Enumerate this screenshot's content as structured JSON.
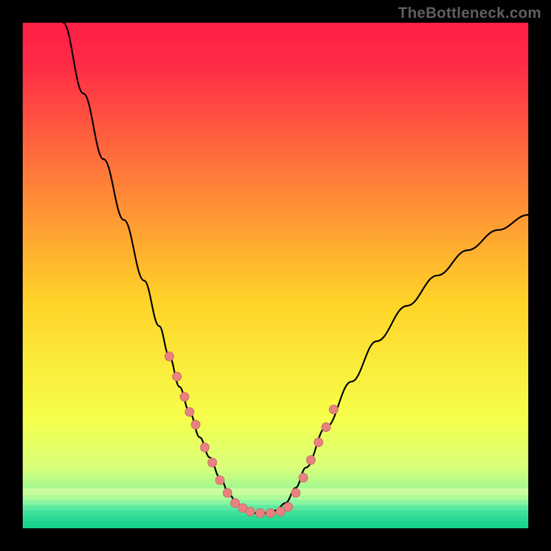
{
  "watermark": "TheBottleneck.com",
  "colors": {
    "gradient_top": "#ff1f44",
    "gradient_mid": "#ffdd22",
    "gradient_bottom": "#12d88a",
    "curve": "#000000",
    "dot_fill": "#e9817f",
    "dot_stroke": "#c06667",
    "frame": "#000000"
  },
  "chart_data": {
    "type": "line",
    "title": "",
    "xlabel": "",
    "ylabel": "",
    "xlim": [
      0,
      100
    ],
    "ylim": [
      0,
      100
    ],
    "grid": false,
    "series": [
      {
        "name": "bottleneck-curve",
        "x": [
          8,
          12,
          16,
          20,
          24,
          27,
          29,
          31,
          33,
          35,
          37,
          39,
          41,
          42.5,
          44,
          46,
          48,
          50,
          52,
          54,
          56,
          60,
          65,
          70,
          76,
          82,
          88,
          94,
          100
        ],
        "y": [
          100,
          86,
          73,
          61,
          49,
          40,
          34,
          28,
          23,
          18,
          14,
          10,
          6.5,
          4.5,
          3.5,
          3,
          3,
          3.5,
          5,
          8,
          12,
          20,
          29,
          37,
          44,
          50,
          55,
          59,
          62
        ]
      }
    ],
    "marker_points": {
      "name": "highlight-dots",
      "x": [
        29,
        30.5,
        32,
        33,
        34.2,
        36,
        37.5,
        39,
        40.5,
        42,
        43.5,
        45,
        47,
        49,
        51,
        52.5,
        54,
        55.5,
        57,
        58.5,
        60,
        61.5
      ],
      "y": [
        34,
        30,
        26,
        23,
        20.5,
        16,
        13,
        9.5,
        7,
        5,
        4,
        3.3,
        3,
        3,
        3.3,
        4.2,
        7,
        10,
        13.5,
        17,
        20,
        23.5
      ]
    },
    "green_band": {
      "y_start": 0,
      "y_end": 9
    }
  }
}
